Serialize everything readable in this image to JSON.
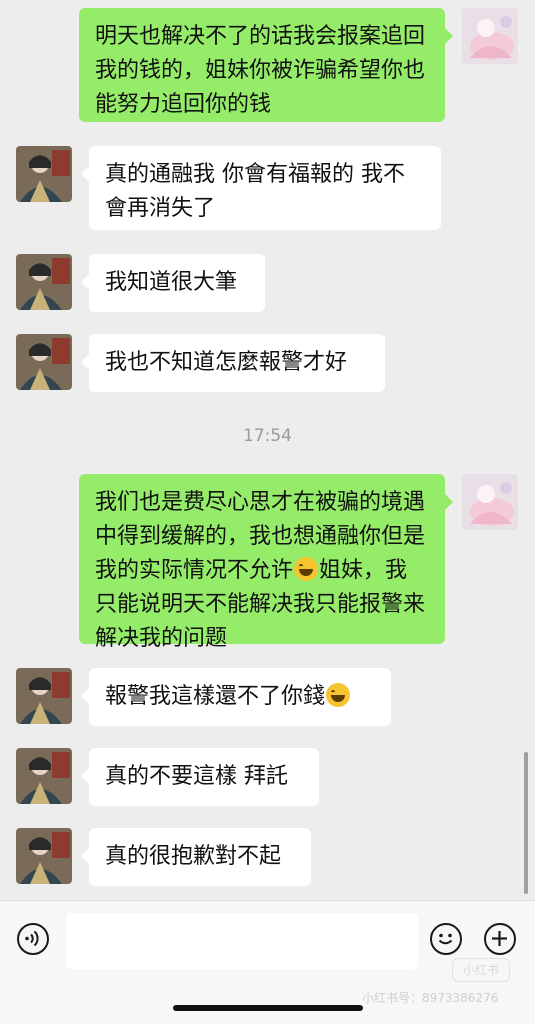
{
  "messages": [
    {
      "side": "self",
      "text": "明天也解决不了的话我会报案追回我的钱的，姐妹你被诈骗希望你也能努力追回你的钱"
    },
    {
      "side": "other",
      "text": "真的通融我 你會有福報的 我不會再消失了"
    },
    {
      "side": "other",
      "text": "我知道很大筆"
    },
    {
      "side": "other",
      "text": "我也不知道怎麼報警才好"
    },
    {
      "side": "self",
      "text": "我们也是费尽心思才在被骗的境遇中得到缓解的，我也想通融你但是我的实际情况不允许",
      "emoji": "tears-of-joy",
      "text_after": "姐妹，我只能说明天不能解决我只能报警来解决我的问题"
    },
    {
      "side": "other",
      "text": "報警我這樣還不了你錢",
      "emoji": "tears-of-joy"
    },
    {
      "side": "other",
      "text": "真的不要這樣 拜託"
    },
    {
      "side": "other",
      "text": "真的很抱歉對不起"
    }
  ],
  "timestamp": "17:54",
  "input_bar": {
    "voice_icon": "voice-icon",
    "emoji_icon": "emoji-face-icon",
    "plus_icon": "plus-icon",
    "text_value": ""
  },
  "watermark": {
    "logo_text": "小红书",
    "id_text": "小红书号：8973386276"
  },
  "colors": {
    "self_bubble": "#95ec69",
    "other_bubble": "#ffffff",
    "background": "#ededed"
  }
}
